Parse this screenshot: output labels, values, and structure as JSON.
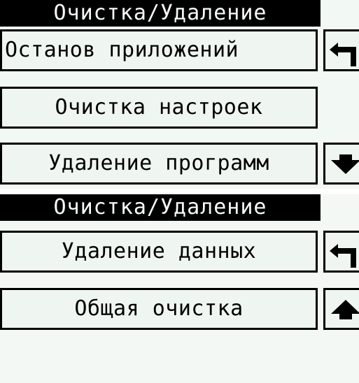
{
  "screens": [
    {
      "title": "Очистка/Удаление",
      "items": [
        {
          "label": "Останов приложений"
        },
        {
          "label": "Очистка настроек"
        },
        {
          "label": "Удаление программ"
        }
      ],
      "side_buttons": [
        {
          "icon": "back-arrow-icon"
        },
        {
          "icon": "arrow-down-icon"
        }
      ]
    },
    {
      "title": "Очистка/Удаление",
      "items": [
        {
          "label": "Удаление данных"
        },
        {
          "label": "Общая очистка"
        }
      ],
      "side_buttons": [
        {
          "icon": "back-arrow-icon"
        },
        {
          "icon": "arrow-up-icon"
        }
      ]
    }
  ],
  "colors": {
    "title_bg": "#000000",
    "title_text": "#f6fbf7",
    "button_bg": "#eff6f1",
    "border": "#000000"
  }
}
